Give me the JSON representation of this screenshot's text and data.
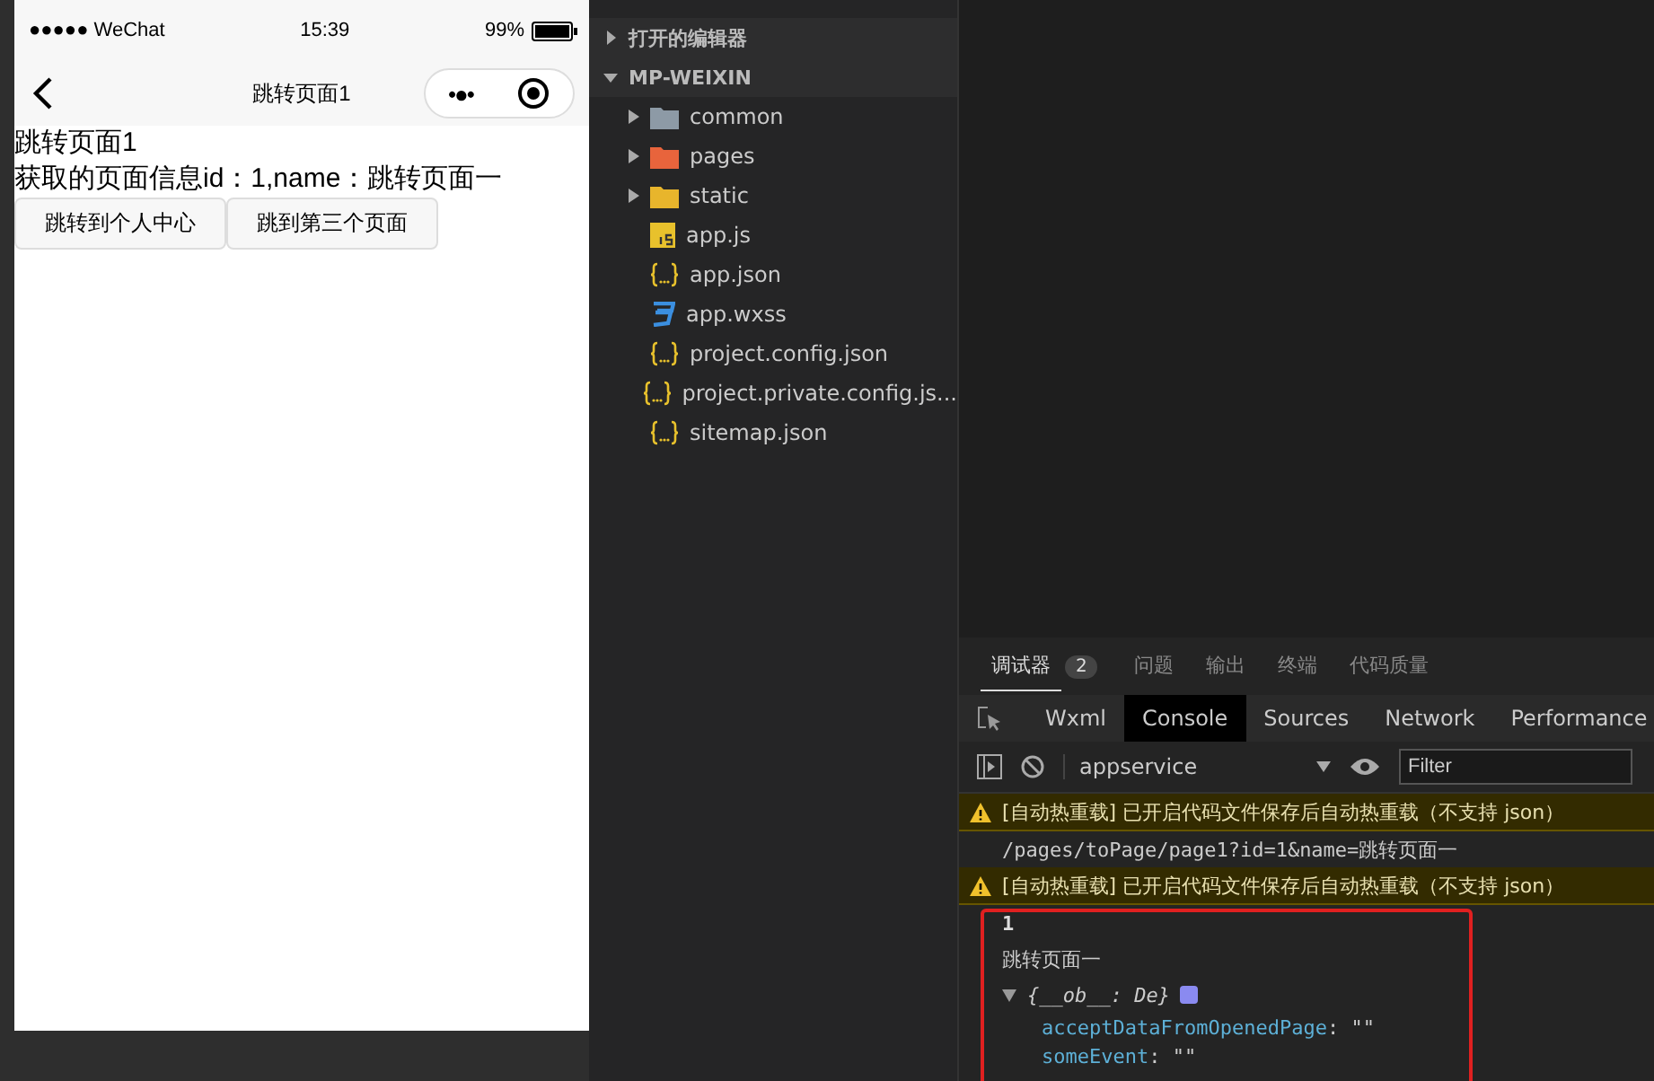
{
  "phone": {
    "status_bar": {
      "carrier": "●●●●● WeChat",
      "time": "15:39",
      "battery": "99%"
    },
    "nav_title": "跳转页面1",
    "nav_capsule_dots": "•●•",
    "content": {
      "heading": "跳转页面1",
      "info": "获取的页面信息id：1,name：跳转页面一",
      "buttons": [
        "跳转到个人中心",
        "跳到第三个页面"
      ]
    }
  },
  "explorer": {
    "sections": [
      {
        "label": "打开的编辑器",
        "expanded": false
      },
      {
        "label": "MP-WEIXIN",
        "expanded": true
      }
    ],
    "items": [
      {
        "name": "common",
        "kind": "folder",
        "color": "#8d9aa6"
      },
      {
        "name": "pages",
        "kind": "folder",
        "color": "#e8643c"
      },
      {
        "name": "static",
        "kind": "folder",
        "color": "#e8b52c"
      },
      {
        "name": "app.js",
        "kind": "js",
        "color": "#e8c12c"
      },
      {
        "name": "app.json",
        "kind": "json",
        "color": "#e8c12c"
      },
      {
        "name": "app.wxss",
        "kind": "css",
        "color": "#3b8fe0"
      },
      {
        "name": "project.config.json",
        "kind": "json",
        "color": "#e8c12c"
      },
      {
        "name": "project.private.config.js...",
        "kind": "json",
        "color": "#e8c12c"
      },
      {
        "name": "sitemap.json",
        "kind": "json",
        "color": "#e8c12c"
      }
    ]
  },
  "panel": {
    "tabs": [
      {
        "label": "调试器",
        "selected": true,
        "badge": "2"
      },
      {
        "label": "问题",
        "selected": false
      },
      {
        "label": "输出",
        "selected": false
      },
      {
        "label": "终端",
        "selected": false
      },
      {
        "label": "代码质量",
        "selected": false
      }
    ],
    "devtools_tabs": [
      {
        "label": "Wxml",
        "selected": false
      },
      {
        "label": "Console",
        "selected": true
      },
      {
        "label": "Sources",
        "selected": false
      },
      {
        "label": "Network",
        "selected": false
      },
      {
        "label": "Performance",
        "selected": false
      }
    ],
    "context": "appservice",
    "filter_placeholder": "Filter",
    "console": [
      {
        "kind": "warning",
        "text": "[自动热重载] 已开启代码文件保存后自动热重载（不支持 json）"
      },
      {
        "kind": "log",
        "text": "/pages/toPage/page1?id=1&name=跳转页面一"
      },
      {
        "kind": "warning",
        "text": "[自动热重载] 已开启代码文件保存后自动热重载（不支持 json）"
      },
      {
        "kind": "number",
        "text": "1"
      },
      {
        "kind": "plain",
        "text": "跳转页面一"
      },
      {
        "kind": "object",
        "text": "{__ob__: De}"
      },
      {
        "kind": "prop",
        "key": "acceptDataFromOpenedPage",
        "value": ": \"\""
      },
      {
        "kind": "prop",
        "key": "someEvent",
        "value": ": \"\""
      }
    ]
  }
}
